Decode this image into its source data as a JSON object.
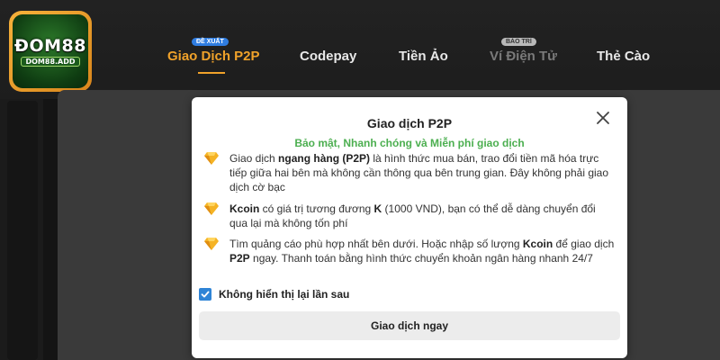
{
  "brand": {
    "logo_main": "ĐOM88",
    "logo_sub": "DOM88.ADD"
  },
  "nav": {
    "tabs": [
      {
        "label": "Giao Dịch P2P",
        "badge": "ĐỀ XUẤT",
        "state": "active"
      },
      {
        "label": "Codepay",
        "badge": "",
        "state": "normal"
      },
      {
        "label": "Tiền Ảo",
        "badge": "",
        "state": "normal"
      },
      {
        "label": "Ví Điện Tử",
        "badge": "BẢO TRÌ",
        "state": "disabled"
      },
      {
        "label": "Thẻ Cào",
        "badge": "",
        "state": "normal"
      }
    ]
  },
  "modal": {
    "title": "Giao dịch P2P",
    "subtitle": "Bảo mật, Nhanh chóng và Miễn phí giao dịch",
    "items": [
      {
        "p1": "Giao dịch ",
        "b1": "ngang hàng (P2P)",
        "p2": " là hình thức mua bán, trao đổi tiền mã hóa trực tiếp giữa hai bên mà không cần thông qua bên trung gian. Đây không phải giao dịch cờ bạc",
        "b2": "",
        "p3": ""
      },
      {
        "p1": "",
        "b1": "Kcoin",
        "p2": " có giá trị tương đương ",
        "b2": "K",
        "p3": " (1000 VND), bạn có thể dễ dàng chuyển đổi qua lại mà không tốn phí"
      },
      {
        "p1": "Tìm quảng cáo phù hợp nhất bên dưới. Hoặc nhập số lượng ",
        "b1": "Kcoin",
        "p2": " để giao dịch ",
        "b2": "P2P",
        "p3": " ngay. Thanh toán bằng hình thức chuyển khoản ngân hàng nhanh 24/7"
      }
    ],
    "checkbox_label": "Không hiển thị lại lần sau",
    "checkbox_checked": true,
    "action_label": "Giao dịch ngay"
  },
  "colors": {
    "accent": "#f0a22a",
    "success": "#4caf50",
    "badge_blue": "#2f7de1",
    "checkbox": "#2f84d6"
  },
  "icons": {
    "close": "close-icon",
    "bullet": "diamond-icon",
    "check": "check-icon"
  }
}
